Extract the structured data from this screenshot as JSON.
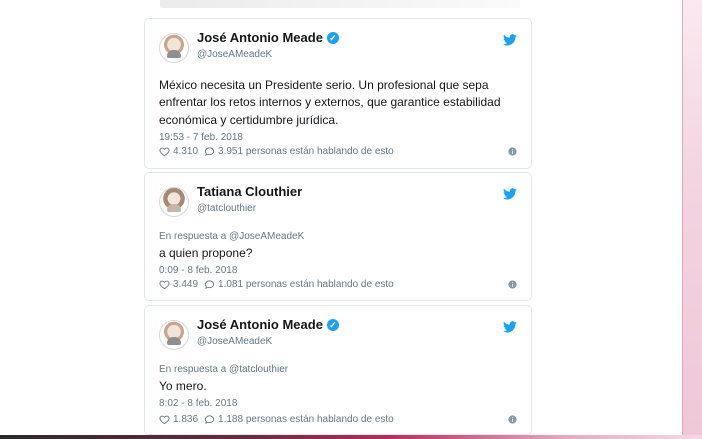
{
  "tweets": [
    {
      "name": "José Antonio Meade",
      "handle": "@JoseAMeadeK",
      "verified": true,
      "reply_to": null,
      "text": "México necesita un Presidente serio. Un profesional que sepa enfrentar los retos internos y externos, que garantice estabilidad económica y certidumbre jurídica.",
      "timestamp": "19:53 - 7 feb. 2018",
      "likes": "4.310",
      "conversation": "3.951 personas están hablando de esto"
    },
    {
      "name": "Tatiana Clouthier",
      "handle": "@tatclouthier",
      "verified": false,
      "reply_to": "En respuesta a @JoseAMeadeK",
      "text": "a quien propone?",
      "timestamp": "0:09 - 8 feb. 2018",
      "likes": "3.449",
      "conversation": "1.081 personas están hablando de esto"
    },
    {
      "name": "José Antonio Meade",
      "handle": "@JoseAMeadeK",
      "verified": true,
      "reply_to": "En respuesta a @tatclouthier",
      "text": "Yo mero.",
      "timestamp": "8:02 - 8 feb. 2018",
      "likes": "1.836",
      "conversation": "1.188 personas están hablando de esto"
    }
  ],
  "icons": {
    "verified": "verified-icon",
    "bird": "twitter-bird-icon",
    "like": "heart-icon",
    "reply": "reply-icon",
    "info": "info-icon"
  },
  "colors": {
    "twitter_blue": "#1da1f2",
    "muted": "#657786",
    "text": "#14171a",
    "border": "#e1e8ed"
  }
}
